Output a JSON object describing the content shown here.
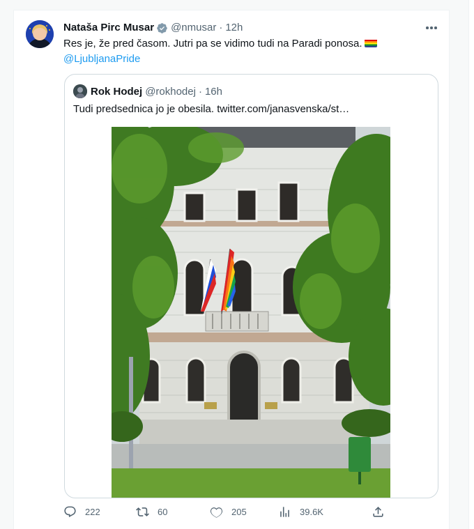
{
  "tweet": {
    "author_name": "Nataša Pirc Musar",
    "author_handle": "@nmusar",
    "separator": "·",
    "time": "12h",
    "text": "Res je, že pred časom. Jutri pa se vidimo tudi na Paradi ponosa.",
    "emoji": "rainbow-flag",
    "mention": "@LjubljanaPride"
  },
  "quote": {
    "author_name": "Rok Hodej",
    "author_handle": "@rokhodej",
    "separator": "·",
    "time": "16h",
    "text": "Tudi predsednica jo je obesila.  twitter.com/janasvenska/st…"
  },
  "actions": {
    "replies": "222",
    "reposts": "60",
    "likes": "205",
    "views": "39.6K"
  },
  "colors": {
    "accent": "#1d9bf0",
    "secondary_text": "#536471",
    "border": "#cfd9de"
  }
}
